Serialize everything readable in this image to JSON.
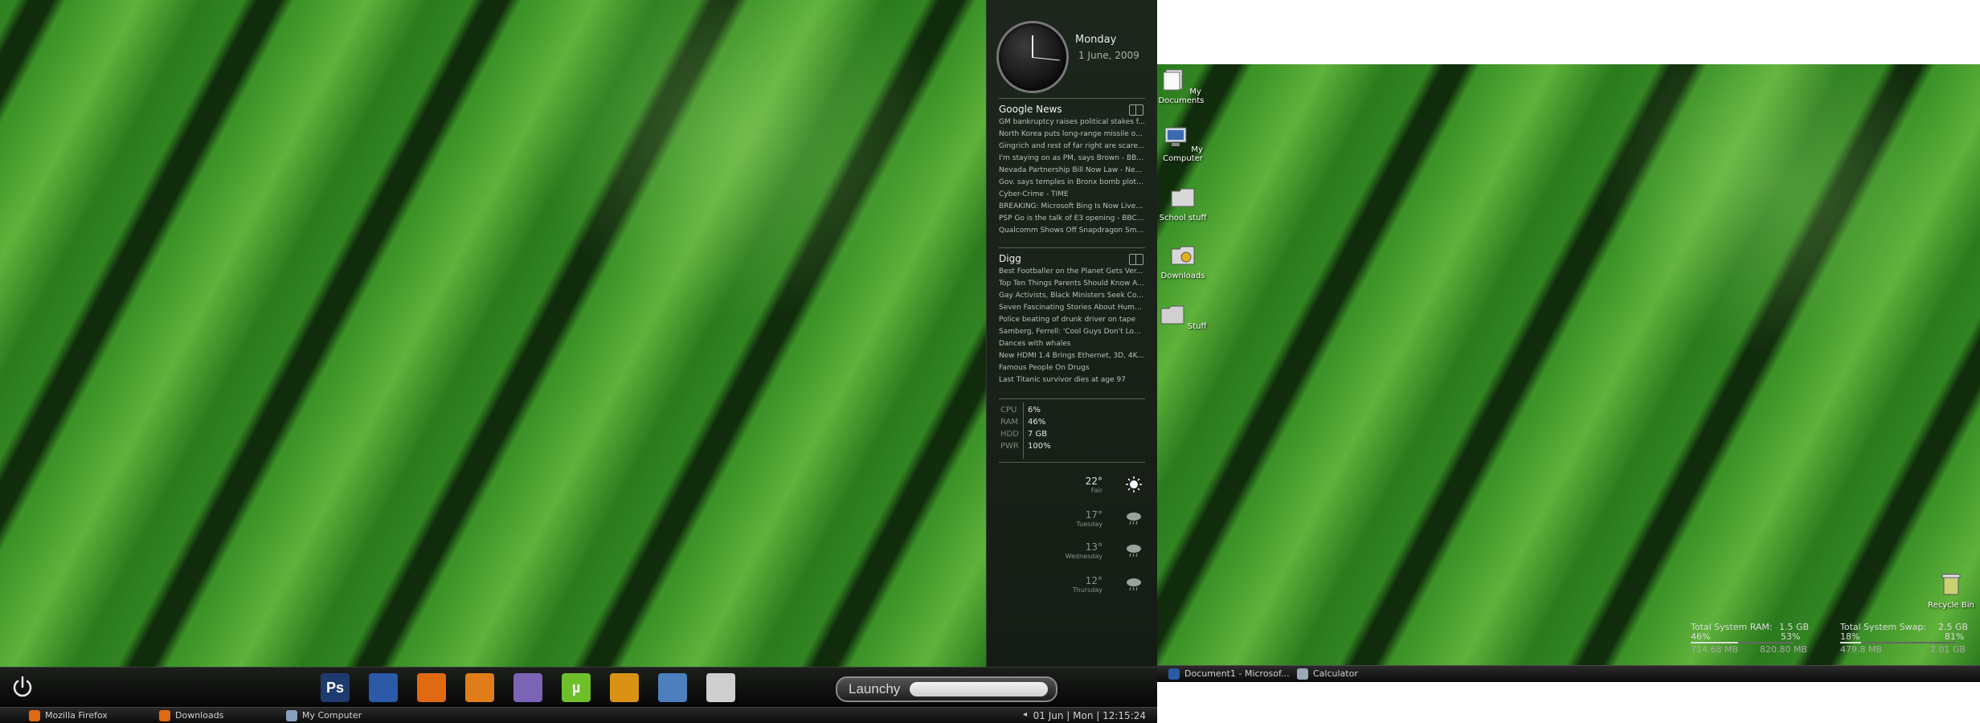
{
  "left": {
    "clock": {
      "day": "Monday",
      "date": "1 June, 2009"
    },
    "google_news": {
      "title": "Google News",
      "items": [
        "GM bankruptcy raises political stakes f...",
        "North Korea puts long-range missile on...",
        "Gingrich and rest of far right are scare...",
        "I'm staying on as PM, says Brown - BBC...",
        "Nevada Partnership Bill Now Law - New...",
        "Gov. says temples in Bronx bomb plot t...",
        "Cyber-Crime - TIME",
        "BREAKING: Microsoft Bing Is Now Live -...",
        "PSP Go is the talk of E3 opening - BBC...",
        "Qualcomm Shows Off Snapdragon Smar..."
      ]
    },
    "digg": {
      "title": "Digg",
      "items": [
        "Best Footballer on the Planet Gets Ver...",
        "Top Ten Things Parents Should Know A...",
        "Gay Activists, Black Ministers Seek Co...",
        "Seven Fascinating Stories About Human...",
        "Police beating of drunk driver on tape",
        "Samberg, Ferrell: 'Cool Guys Don't Look...",
        "Dances with whales",
        "New HDMI 1.4 Brings Ethernet, 3D, 4Ka...",
        "Famous People On Drugs",
        "Last Titanic survivor dies at age 97"
      ]
    },
    "stats": [
      {
        "label": "CPU",
        "value": "6%"
      },
      {
        "label": "RAM",
        "value": "46%"
      },
      {
        "label": "HDD",
        "value": "7 GB"
      },
      {
        "label": "PWR",
        "value": "100%"
      }
    ],
    "weather": [
      {
        "temp": "22°",
        "desc": "Fair",
        "icon": "sun-icon"
      },
      {
        "temp": "17°",
        "desc": "Tuesday",
        "icon": "rain-cloud-icon"
      },
      {
        "temp": "13°",
        "desc": "Wednesday",
        "icon": "rain-cloud-icon"
      },
      {
        "temp": "12°",
        "desc": "Thursday",
        "icon": "rain-cloud-icon"
      }
    ],
    "dock": {
      "apps": [
        {
          "name": "photoshop",
          "text": "Ps",
          "color": "#1d3b6e"
        },
        {
          "name": "word",
          "text": "",
          "color": "#2a5aa8"
        },
        {
          "name": "firefox",
          "text": "",
          "color": "#e06a12"
        },
        {
          "name": "songbird",
          "text": "",
          "color": "#e07d18"
        },
        {
          "name": "pidgin",
          "text": "",
          "color": "#7b64b5"
        },
        {
          "name": "utorrent",
          "text": "µ",
          "color": "#6fbf2a"
        },
        {
          "name": "miranda",
          "text": "",
          "color": "#d99214"
        },
        {
          "name": "text-editor",
          "text": "",
          "color": "#4d7fbf"
        },
        {
          "name": "terminal",
          "text": "",
          "color": "#cfcfcf"
        }
      ],
      "launchy_label": "Launchy"
    },
    "taskbar": {
      "buttons": [
        "Mozilla Firefox",
        "Downloads",
        "My Computer"
      ],
      "clock": "01 Jun | Mon | 12:15:24"
    }
  },
  "right": {
    "desktop_icons": [
      "My Documents",
      "My Computer",
      "School stuff",
      "Downloads",
      "Stuff"
    ],
    "recycle_bin": "Recycle Bin",
    "sysmon": {
      "ram_label": "Total System RAM:",
      "ram_total": "1.5 GB",
      "ram_used_pct": "46%",
      "ram_free_pct": "53%",
      "ram_used": "714.68 MB",
      "ram_free": "820.80 MB",
      "swap_label": "Total System Swap:",
      "swap_total": "2.5 GB",
      "swap_used_pct": "18%",
      "swap_free_pct": "81%",
      "swap_used": "479.8 MB",
      "swap_free": "2.01 GB"
    },
    "taskbar": {
      "buttons": [
        "Document1 - Microsof...",
        "Calculator"
      ]
    }
  }
}
